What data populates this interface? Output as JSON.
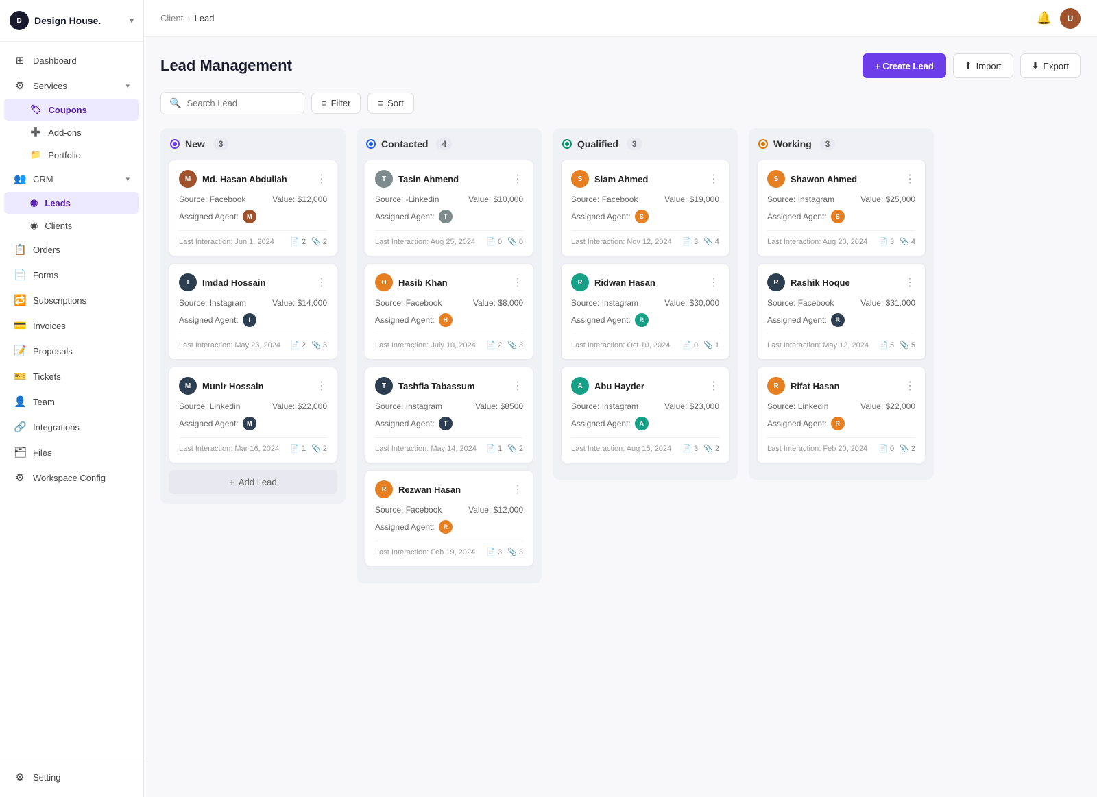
{
  "app": {
    "name": "Design House.",
    "logo_initial": "D"
  },
  "breadcrumb": {
    "parent": "Client",
    "current": "Lead"
  },
  "topbar": {
    "notification_icon": "🔔",
    "user_initial": "U"
  },
  "page": {
    "title": "Lead Management",
    "create_btn": "+ Create Lead",
    "import_btn": "Import",
    "export_btn": "Export"
  },
  "toolbar": {
    "search_placeholder": "Search Lead",
    "filter_label": "Filter",
    "sort_label": "Sort"
  },
  "sidebar": {
    "items": [
      {
        "id": "dashboard",
        "label": "Dashboard",
        "icon": "⊞"
      },
      {
        "id": "services",
        "label": "Services",
        "icon": "⚙",
        "has_chevron": true,
        "expanded": true
      },
      {
        "id": "coupons",
        "label": "Coupons",
        "icon": "🏷",
        "is_sub": true
      },
      {
        "id": "addons",
        "label": "Add-ons",
        "icon": "➕",
        "is_sub": true
      },
      {
        "id": "portfolio",
        "label": "Portfolio",
        "icon": "📁",
        "is_sub": true
      },
      {
        "id": "crm",
        "label": "CRM",
        "icon": "👥",
        "has_chevron": true,
        "expanded": true
      },
      {
        "id": "leads",
        "label": "Leads",
        "icon": "◉",
        "is_sub": true,
        "active": true
      },
      {
        "id": "clients",
        "label": "Clients",
        "icon": "◉",
        "is_sub": true
      },
      {
        "id": "orders",
        "label": "Orders",
        "icon": "📋"
      },
      {
        "id": "forms",
        "label": "Forms",
        "icon": "📄"
      },
      {
        "id": "subscriptions",
        "label": "Subscriptions",
        "icon": "🔁"
      },
      {
        "id": "invoices",
        "label": "Invoices",
        "icon": "💳"
      },
      {
        "id": "proposals",
        "label": "Proposals",
        "icon": "📝"
      },
      {
        "id": "tickets",
        "label": "Tickets",
        "icon": "🎫"
      },
      {
        "id": "team",
        "label": "Team",
        "icon": "👤"
      },
      {
        "id": "integrations",
        "label": "Integrations",
        "icon": "🔗"
      },
      {
        "id": "files",
        "label": "Files",
        "icon": "🗂"
      },
      {
        "id": "workspace_config",
        "label": "Workspace Config",
        "icon": "⚙"
      }
    ],
    "bottom": [
      {
        "id": "setting",
        "label": "Setting",
        "icon": "⚙"
      }
    ]
  },
  "columns": [
    {
      "id": "new",
      "title": "New",
      "count": "3",
      "status": "new",
      "leads": [
        {
          "name": "Md. Hasan Abdullah",
          "source": "Facebook",
          "value": "$12,000",
          "agent_label": "Assigned Agent:",
          "agent_color": "av-brown",
          "last_interaction": "Jun 1, 2024",
          "files": "2",
          "attachments": "2"
        },
        {
          "name": "Imdad Hossain",
          "source": "Instagram",
          "value": "$14,000",
          "agent_label": "Assigned Agent:",
          "agent_color": "av-dark",
          "last_interaction": "May 23, 2024",
          "files": "2",
          "attachments": "3"
        },
        {
          "name": "Munir Hossain",
          "source": "Linkedin",
          "value": "$22,000",
          "agent_label": "Assigned Agent:",
          "agent_color": "av-dark",
          "last_interaction": "Mar 16, 2024",
          "files": "1",
          "attachments": "2"
        }
      ],
      "add_label": "+ Add Lead"
    },
    {
      "id": "contacted",
      "title": "Contacted",
      "count": "4",
      "status": "contacted",
      "leads": [
        {
          "name": "Tasin Ahmend",
          "source": "-Linkedin",
          "value": "$10,000",
          "agent_label": "Assigned Agent:",
          "agent_color": "av-gray",
          "last_interaction": "Aug 25, 2024",
          "files": "0",
          "attachments": "0"
        },
        {
          "name": "Hasib Khan",
          "source": "Facebook",
          "value": "$8,000",
          "agent_label": "Assigned Agent:",
          "agent_color": "av-orange",
          "last_interaction": "July 10, 2024",
          "files": "2",
          "attachments": "3"
        },
        {
          "name": "Tashfia Tabassum",
          "source": "Instagram",
          "value": "$8500",
          "agent_label": "Assigned Agent:",
          "agent_color": "av-dark",
          "last_interaction": "May 14, 2024",
          "files": "1",
          "attachments": "2"
        },
        {
          "name": "Rezwan Hasan",
          "source": "Facebook",
          "value": "$12,000",
          "agent_label": "Assigned Agent:",
          "agent_color": "av-orange",
          "last_interaction": "Feb 19, 2024",
          "files": "3",
          "attachments": "3"
        }
      ]
    },
    {
      "id": "qualified",
      "title": "Qualified",
      "count": "3",
      "status": "qualified",
      "leads": [
        {
          "name": "Siam Ahmed",
          "source": "Facebook",
          "value": "$19,000",
          "agent_label": "Assigned Agent:",
          "agent_color": "av-orange",
          "last_interaction": "Nov 12, 2024",
          "files": "3",
          "attachments": "4"
        },
        {
          "name": "Ridwan Hasan",
          "source": "Instagram",
          "value": "$30,000",
          "agent_label": "Assigned Agent:",
          "agent_color": "av-teal",
          "last_interaction": "Oct 10, 2024",
          "files": "0",
          "attachments": "1"
        },
        {
          "name": "Abu Hayder",
          "source": "Instagram",
          "value": "$23,000",
          "agent_label": "Assigned Agent:",
          "agent_color": "av-teal",
          "last_interaction": "Aug 15, 2024",
          "files": "3",
          "attachments": "2"
        }
      ]
    },
    {
      "id": "working",
      "title": "Working",
      "count": "3",
      "status": "working",
      "leads": [
        {
          "name": "Shawon Ahmed",
          "source": "Instagram",
          "value": "$25,000",
          "agent_label": "Assigned Agent:",
          "agent_color": "av-orange",
          "last_interaction": "Aug 20, 2024",
          "files": "3",
          "attachments": "4"
        },
        {
          "name": "Rashik Hoque",
          "source": "Facebook",
          "value": "$31,000",
          "agent_label": "Assigned Agent:",
          "agent_color": "av-dark",
          "last_interaction": "May 12, 2024",
          "files": "5",
          "attachments": "5"
        },
        {
          "name": "Rifat Hasan",
          "source": "Linkedin",
          "value": "$22,000",
          "agent_label": "Assigned Agent:",
          "agent_color": "av-orange",
          "last_interaction": "Feb 20, 2024",
          "files": "0",
          "attachments": "2"
        }
      ]
    }
  ]
}
